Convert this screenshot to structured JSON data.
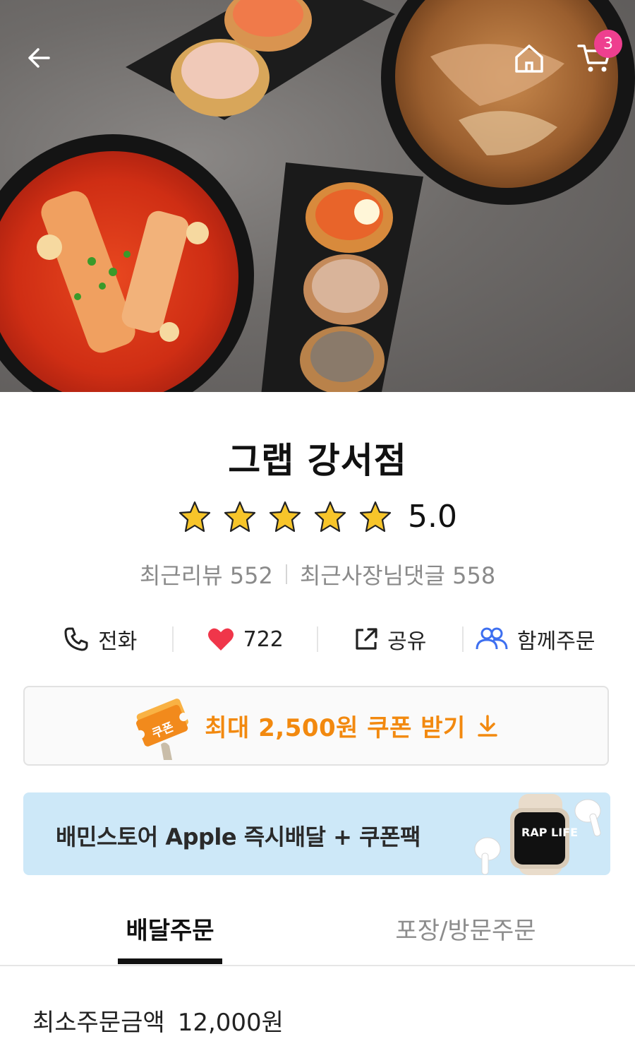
{
  "header": {
    "back_icon": "arrow-left-icon",
    "home_icon": "home-icon",
    "cart_icon": "cart-icon",
    "cart_count": "3"
  },
  "store": {
    "name": "그랩 강서점",
    "rating": "5.0",
    "stars": 5,
    "recent_reviews_label": "최근리뷰",
    "recent_reviews_count": "552",
    "owner_replies_label": "최근사장님댓글",
    "owner_replies_count": "558"
  },
  "actions": {
    "call_label": "전화",
    "like_count": "722",
    "share_label": "공유",
    "group_order_label": "함께주문"
  },
  "coupon": {
    "badge_text": "쿠폰",
    "label": "최대 2,500원 쿠폰 받기"
  },
  "banner": {
    "text": "배민스토어 Apple 즉시배달 + 쿠폰팩",
    "watch_text": "RAP LIFE"
  },
  "tabs": {
    "delivery_label": "배달주문",
    "pickup_label": "포장/방문주문",
    "active": "delivery"
  },
  "order": {
    "min_order_label": "최소주문금액",
    "min_order_value": "12,000원"
  },
  "colors": {
    "accent_orange": "#f2890f",
    "badge_pink": "#ee3f8f",
    "banner_bg": "#cde8f8",
    "heart_red": "#f0364a",
    "group_blue": "#3d6ff0"
  }
}
